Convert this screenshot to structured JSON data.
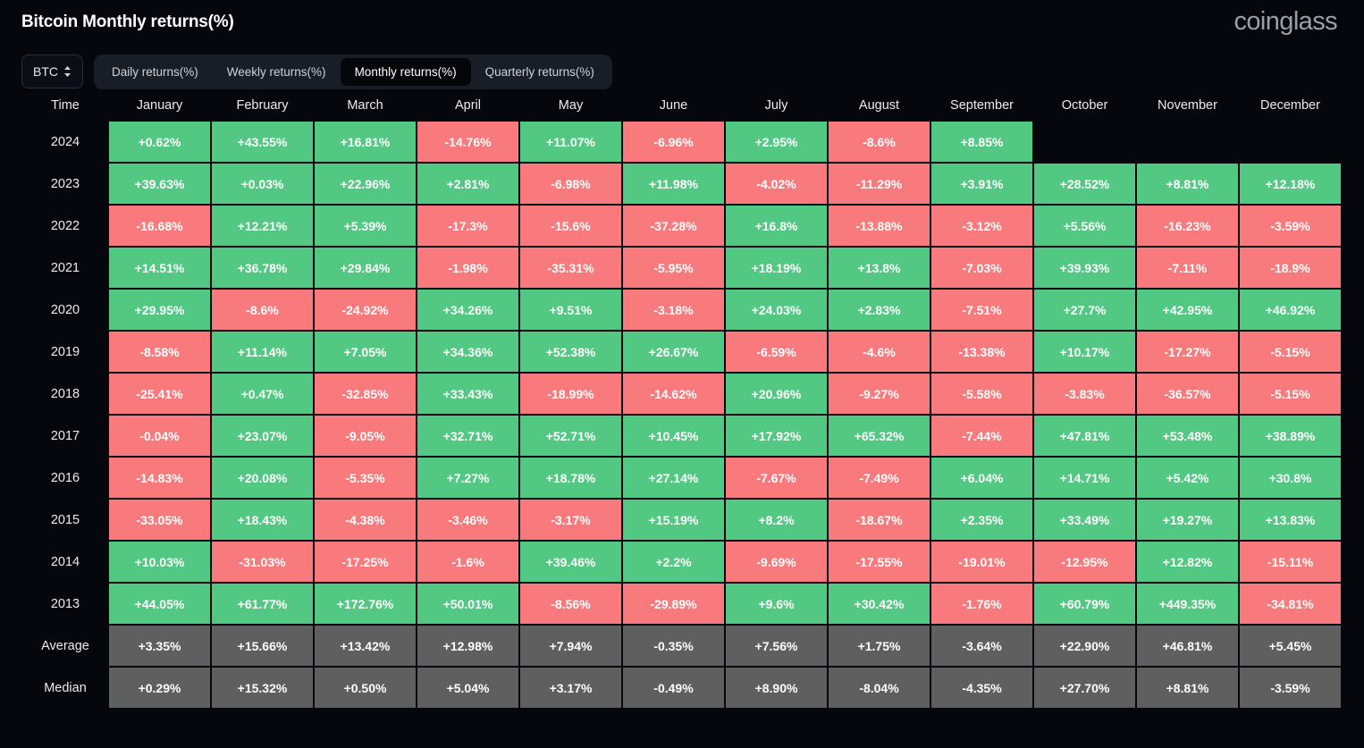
{
  "header": {
    "title": "Bitcoin Monthly returns(%)",
    "brand": "coinglass"
  },
  "controls": {
    "symbol": "BTC",
    "tabs": [
      {
        "label": "Daily returns(%)",
        "active": false
      },
      {
        "label": "Weekly returns(%)",
        "active": false
      },
      {
        "label": "Monthly returns(%)",
        "active": true
      },
      {
        "label": "Quarterly returns(%)",
        "active": false
      }
    ]
  },
  "colors": {
    "positive": "#52c883",
    "negative": "#f97a7d",
    "stat": "#5f5f5f",
    "background": "#05070c",
    "brand": "#97a0ab"
  },
  "chart_data": {
    "type": "heatmap",
    "title": "Bitcoin Monthly returns(%)",
    "xlabel": "Time",
    "ylabel": "",
    "columns": [
      "Time",
      "January",
      "February",
      "March",
      "April",
      "May",
      "June",
      "July",
      "August",
      "September",
      "October",
      "November",
      "December"
    ],
    "categories": [
      "January",
      "February",
      "March",
      "April",
      "May",
      "June",
      "July",
      "August",
      "September",
      "October",
      "November",
      "December"
    ],
    "rows": [
      {
        "label": "2024",
        "kind": "year",
        "values": [
          "+0.62%",
          "+43.55%",
          "+16.81%",
          "-14.76%",
          "+11.07%",
          "-6.96%",
          "+2.95%",
          "-8.6%",
          "+8.85%",
          "",
          "",
          ""
        ]
      },
      {
        "label": "2023",
        "kind": "year",
        "values": [
          "+39.63%",
          "+0.03%",
          "+22.96%",
          "+2.81%",
          "-6.98%",
          "+11.98%",
          "-4.02%",
          "-11.29%",
          "+3.91%",
          "+28.52%",
          "+8.81%",
          "+12.18%"
        ]
      },
      {
        "label": "2022",
        "kind": "year",
        "values": [
          "-16.68%",
          "+12.21%",
          "+5.39%",
          "-17.3%",
          "-15.6%",
          "-37.28%",
          "+16.8%",
          "-13.88%",
          "-3.12%",
          "+5.56%",
          "-16.23%",
          "-3.59%"
        ]
      },
      {
        "label": "2021",
        "kind": "year",
        "values": [
          "+14.51%",
          "+36.78%",
          "+29.84%",
          "-1.98%",
          "-35.31%",
          "-5.95%",
          "+18.19%",
          "+13.8%",
          "-7.03%",
          "+39.93%",
          "-7.11%",
          "-18.9%"
        ]
      },
      {
        "label": "2020",
        "kind": "year",
        "values": [
          "+29.95%",
          "-8.6%",
          "-24.92%",
          "+34.26%",
          "+9.51%",
          "-3.18%",
          "+24.03%",
          "+2.83%",
          "-7.51%",
          "+27.7%",
          "+42.95%",
          "+46.92%"
        ]
      },
      {
        "label": "2019",
        "kind": "year",
        "values": [
          "-8.58%",
          "+11.14%",
          "+7.05%",
          "+34.36%",
          "+52.38%",
          "+26.67%",
          "-6.59%",
          "-4.6%",
          "-13.38%",
          "+10.17%",
          "-17.27%",
          "-5.15%"
        ]
      },
      {
        "label": "2018",
        "kind": "year",
        "values": [
          "-25.41%",
          "+0.47%",
          "-32.85%",
          "+33.43%",
          "-18.99%",
          "-14.62%",
          "+20.96%",
          "-9.27%",
          "-5.58%",
          "-3.83%",
          "-36.57%",
          "-5.15%"
        ]
      },
      {
        "label": "2017",
        "kind": "year",
        "values": [
          "-0.04%",
          "+23.07%",
          "-9.05%",
          "+32.71%",
          "+52.71%",
          "+10.45%",
          "+17.92%",
          "+65.32%",
          "-7.44%",
          "+47.81%",
          "+53.48%",
          "+38.89%"
        ]
      },
      {
        "label": "2016",
        "kind": "year",
        "values": [
          "-14.83%",
          "+20.08%",
          "-5.35%",
          "+7.27%",
          "+18.78%",
          "+27.14%",
          "-7.67%",
          "-7.49%",
          "+6.04%",
          "+14.71%",
          "+5.42%",
          "+30.8%"
        ]
      },
      {
        "label": "2015",
        "kind": "year",
        "values": [
          "-33.05%",
          "+18.43%",
          "-4.38%",
          "-3.46%",
          "-3.17%",
          "+15.19%",
          "+8.2%",
          "-18.67%",
          "+2.35%",
          "+33.49%",
          "+19.27%",
          "+13.83%"
        ]
      },
      {
        "label": "2014",
        "kind": "year",
        "values": [
          "+10.03%",
          "-31.03%",
          "-17.25%",
          "-1.6%",
          "+39.46%",
          "+2.2%",
          "-9.69%",
          "-17.55%",
          "-19.01%",
          "-12.95%",
          "+12.82%",
          "-15.11%"
        ]
      },
      {
        "label": "2013",
        "kind": "year",
        "values": [
          "+44.05%",
          "+61.77%",
          "+172.76%",
          "+50.01%",
          "-8.56%",
          "-29.89%",
          "+9.6%",
          "+30.42%",
          "-1.76%",
          "+60.79%",
          "+449.35%",
          "-34.81%"
        ]
      },
      {
        "label": "Average",
        "kind": "stat",
        "values": [
          "+3.35%",
          "+15.66%",
          "+13.42%",
          "+12.98%",
          "+7.94%",
          "-0.35%",
          "+7.56%",
          "+1.75%",
          "-3.64%",
          "+22.90%",
          "+46.81%",
          "+5.45%"
        ]
      },
      {
        "label": "Median",
        "kind": "stat",
        "values": [
          "+0.29%",
          "+15.32%",
          "+0.50%",
          "+5.04%",
          "+3.17%",
          "-0.49%",
          "+8.90%",
          "-8.04%",
          "-4.35%",
          "+27.70%",
          "+8.81%",
          "-3.59%"
        ]
      }
    ]
  }
}
